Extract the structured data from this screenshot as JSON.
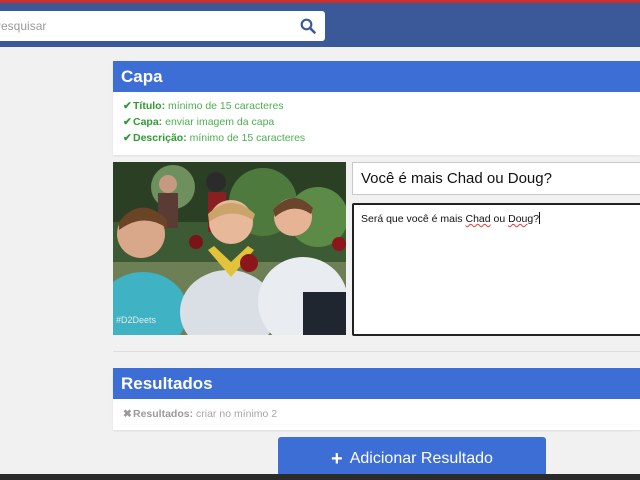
{
  "search": {
    "placeholder": "Pesquisar"
  },
  "cover_section": {
    "title": "Capa",
    "requirements": [
      {
        "label": "Título:",
        "text": "mínimo de 15 caracteres",
        "mark": "✔"
      },
      {
        "label": "Capa:",
        "text": "enviar imagem da capa",
        "mark": "✔"
      },
      {
        "label": "Descrição:",
        "text": "mínimo de 15 caracteres",
        "mark": "✔"
      }
    ],
    "image_caption": "#D2Deets",
    "title_value": "Você é mais Chad ou Doug?",
    "description": {
      "part1": "Será que você é mais ",
      "word1": "Chad",
      "part2": " ou ",
      "word2": "Doug",
      "part3": "?"
    }
  },
  "results_section": {
    "title": "Resultados",
    "requirements": [
      {
        "label": "Resultados:",
        "text": "criar no mínimo 2",
        "mark": "✖"
      }
    ]
  },
  "add_result_button": {
    "label": "Adicionar Resultado",
    "icon": "+"
  },
  "colors": {
    "topbar": "#3b5998",
    "accent": "#3d6ed5",
    "success": "#2e9c32",
    "muted": "#9a9a9a"
  }
}
